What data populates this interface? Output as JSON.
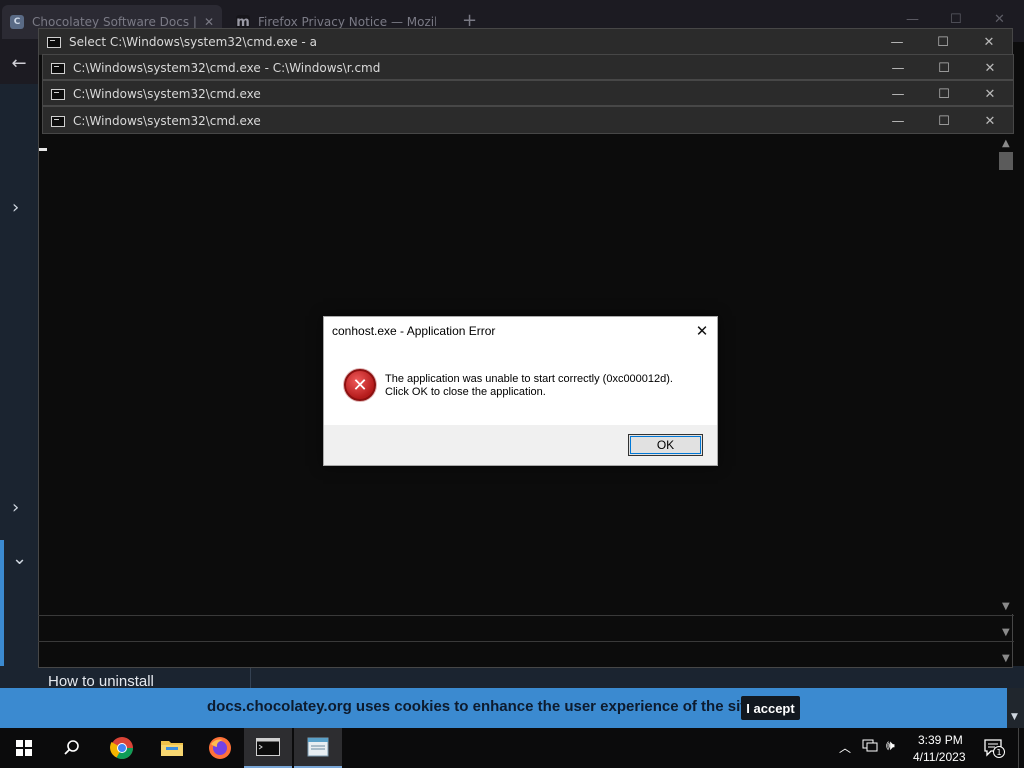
{
  "browser": {
    "tabs": [
      {
        "label": "Chocolatey Software Docs | Se",
        "favicon": "chocolatey-favicon"
      },
      {
        "label": "Firefox Privacy Notice — Mozil",
        "favicon": "mozilla-m-favicon"
      }
    ],
    "new_tab": "+",
    "back_arrow": "←",
    "sidebar_chevrons": [
      "›",
      "›",
      "⌄"
    ],
    "page_heading": "How to uninstall",
    "cookie_banner": {
      "text": "docs.chocolatey.org uses cookies to enhance the user experience of the site.",
      "accept_label": "I accept",
      "color": "#3b8ad0"
    }
  },
  "consoles": [
    {
      "title": "Select C:\\Windows\\system32\\cmd.exe - a",
      "focused": true
    },
    {
      "title": "C:\\Windows\\system32\\cmd.exe - C:\\Windows\\r.cmd"
    },
    {
      "title": "C:\\Windows\\system32\\cmd.exe"
    },
    {
      "title": "C:\\Windows\\system32\\cmd.exe"
    }
  ],
  "window_buttons": {
    "minimize": "—",
    "maximize": "☐",
    "close": "✕"
  },
  "dialog": {
    "title": "conhost.exe - Application Error",
    "message_line1": "The application was unable to start correctly (0xc000012d).",
    "message_line2": "Click OK to close the application.",
    "ok_label": "OK",
    "close_glyph": "✕",
    "icon": "error-x-icon",
    "icon_glyph": "✕"
  },
  "taskbar": {
    "apps": [
      "start-icon",
      "search-icon",
      "chrome-icon",
      "file-explorer-icon",
      "firefox-icon",
      "cmd-icon",
      "notepad-icon"
    ],
    "clock_time": "3:39 PM",
    "clock_date": "4/11/2023",
    "notification_count": "1"
  }
}
